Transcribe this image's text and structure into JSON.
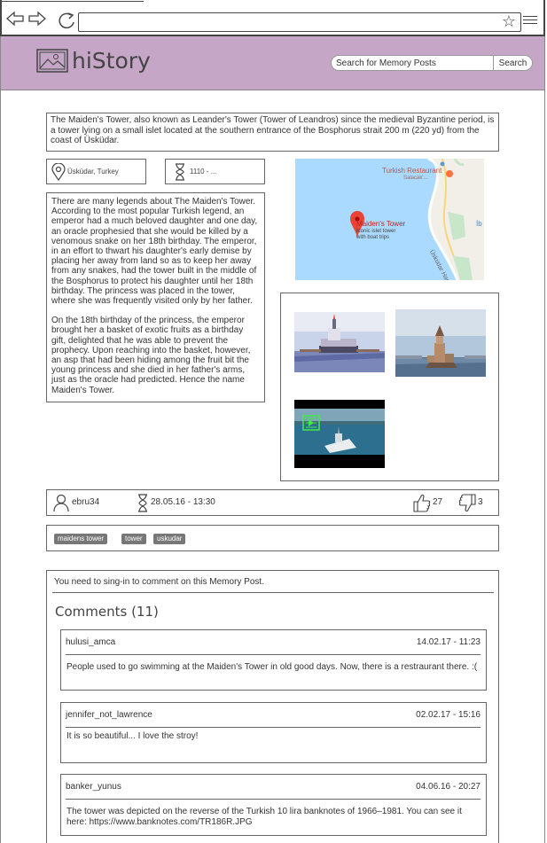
{
  "app": {
    "brand": "hiStory",
    "search_placeholder": "Search for Memory Posts",
    "search_button": "Search"
  },
  "post": {
    "description": "The Maiden's Tower, also known as Leander's Tower (Tower of Leandros) since the medieval Byzantine period, is a tower lying on a small islet located at the southern entrance of the Bosphorus strait 200 m (220 yd) from the coast of Üsküdar.",
    "location": "Üsküdar, Turkey",
    "period": "1110  -  ...",
    "story_p1": "There are many legends about The Maiden's Tower. According to the most popular Turkish legend, an emperor had a much beloved daughter and one day, an oracle prophesied that she would be killed by a venomous snake on her 18th birthday. The emperor, in an effort to thwart his daughter's early demise by placing her away from land so as to keep her away from any snakes, had the tower built in the middle of the Bosphorus to protect his daughter until her 18th birthday. The princess was placed in the tower, where she was frequently visited only by her father.",
    "story_p2": "On the 18th birthday of the princess, the emperor brought her a basket of exotic fruits as a birthday gift, delighted that he was able to prevent the prophecy. Upon reaching into the basket, however, an asp that had been hiding among the fruit bit the young princess and she died in her father's arms, just as the oracle had predicted. Hence the name Maiden's Tower.",
    "author": "ebru34",
    "posted_at": "28.05.16 - 13:30",
    "likes": "27",
    "dislikes": "3",
    "tags": [
      "maidens tower",
      "tower",
      "uskudar"
    ]
  },
  "map": {
    "marker_label": "Maiden's Tower",
    "marker_sub1": "Iconic islet tower",
    "marker_sub2": "with boat trips",
    "poi_label": "Turkish Restaurant",
    "poi_sub": "Salacak'...",
    "road_label": "Üsküdar Harem...",
    "edge_label": "İb"
  },
  "comments": {
    "signin_notice": "You need to sing-in to comment on this Memory Post.",
    "title": "Comments (11)",
    "items": [
      {
        "user": "hulusi_amca",
        "time": "14.02.17 - 11:23",
        "text": "People used to go swimming at the Maiden's Tower in old good days. Now, there is a restraurant there. :("
      },
      {
        "user": "jennifer_not_lawrence",
        "time": "02.02.17 - 15:16",
        "text": "It is so beautiful... I love the stroy!"
      },
      {
        "user": "banker_yunus",
        "time": "04.06.16 - 20:27",
        "text": "The tower was depicted on the reverse of the Turkish 10 lira banknotes of 1966–1981. You can see it here: https://www.banknotes.com/TR186R.JPG"
      }
    ]
  },
  "colors": {
    "header_bg": "#c5a6c6",
    "map_water": "#aadaff",
    "map_pin": "#ea4335",
    "tag_bg": "#777777"
  },
  "icons": [
    "back-arrow-icon",
    "forward-arrow-icon",
    "reload-icon",
    "star-icon",
    "hamburger-menu-icon",
    "image-logo-icon",
    "location-pin-icon",
    "hourglass-icon",
    "user-icon",
    "thumbs-up-icon",
    "thumbs-down-icon"
  ]
}
